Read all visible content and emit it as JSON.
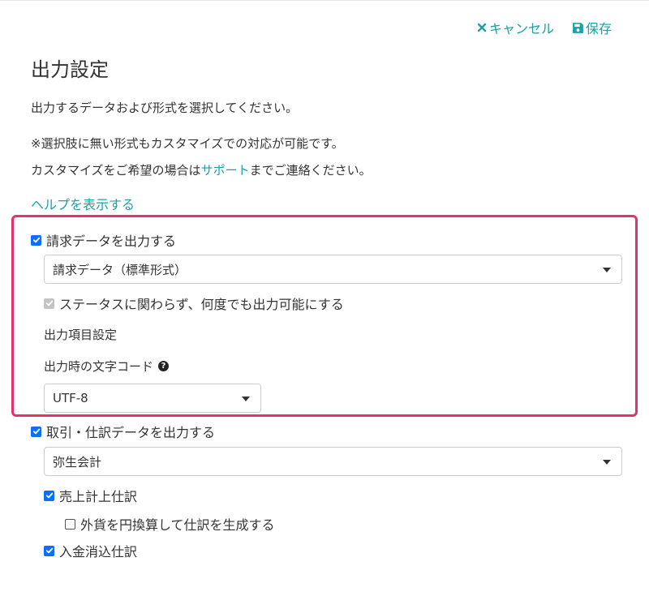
{
  "header": {
    "cancel_label": "キャンセル",
    "save_label": "保存"
  },
  "page_title": "出力設定",
  "intro": "出力するデータおよび形式を選択してください。",
  "note_line1": "※選択肢に無い形式もカスタマイズでの対応が可能です。",
  "note_line2_before": "カスタマイズをご希望の場合は",
  "note_line2_link": "サポート",
  "note_line2_after": "までご連絡ください。",
  "help_link": "ヘルプを表示する",
  "invoice_section": {
    "checkbox_label": "請求データを出力する",
    "checked": true,
    "format_select_value": "請求データ（標準形式）",
    "status_checkbox_label": "ステータスに関わらず、何度でも出力可能にする",
    "status_checked": true,
    "status_disabled": true,
    "item_settings_link": "出力項目設定",
    "encoding_label": "出力時の文字コード",
    "encoding_value": "UTF-8"
  },
  "journal_section": {
    "checkbox_label": "取引・仕訳データを出力する",
    "checked": true,
    "format_select_value": "弥生会計",
    "sales_checkbox_label": "売上計上仕訳",
    "sales_checked": true,
    "fx_checkbox_label": "外貨を円換算して仕訳を生成する",
    "fx_checked": false,
    "payment_checkbox_label": "入金消込仕訳",
    "payment_checked": true
  },
  "colors": {
    "accent": "#1aa1a5",
    "checkbox": "#0d6efd",
    "highlight_border": "#e4336b"
  }
}
